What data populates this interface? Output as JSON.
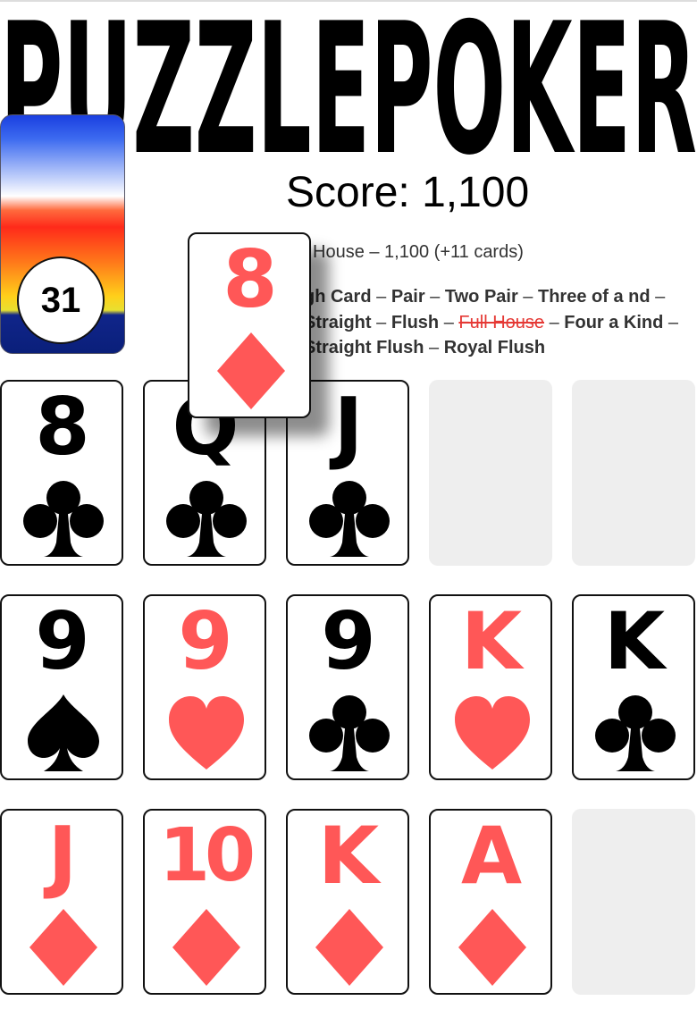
{
  "game": {
    "title": "PUZZLEPOKER",
    "score_text": "Score: 1,100",
    "last_hand": "l House – 1,100 (+11 cards)",
    "timer_value": "31",
    "timer_level": 0.31,
    "hands": [
      {
        "label": "gh Card",
        "done": false
      },
      {
        "label": "Pair",
        "done": false
      },
      {
        "label": "Two Pair",
        "done": false
      },
      {
        "label": "Three of a nd",
        "done": false
      },
      {
        "label": "Straight",
        "done": false
      },
      {
        "label": "Flush",
        "done": false
      },
      {
        "label": "Full House",
        "done": true
      },
      {
        "label": "Four a Kind",
        "done": false
      },
      {
        "label": "Straight Flush",
        "done": false
      },
      {
        "label": "Royal Flush",
        "done": false
      }
    ],
    "separator": " – ",
    "colors": {
      "red": "#ff5757",
      "black": "#000000",
      "empty_slot": "#eeeeee"
    }
  },
  "held_card": {
    "rank": "8",
    "suit": "diamond",
    "color": "red"
  },
  "grid": [
    [
      {
        "rank": "8",
        "suit": "club",
        "color": "black"
      },
      {
        "rank": "Q",
        "suit": "club",
        "color": "black"
      },
      {
        "rank": "J",
        "suit": "club",
        "color": "black"
      },
      null,
      null
    ],
    [
      {
        "rank": "9",
        "suit": "spade",
        "color": "black"
      },
      {
        "rank": "9",
        "suit": "heart",
        "color": "red"
      },
      {
        "rank": "9",
        "suit": "club",
        "color": "black"
      },
      {
        "rank": "K",
        "suit": "heart",
        "color": "red"
      },
      {
        "rank": "K",
        "suit": "club",
        "color": "black"
      }
    ],
    [
      {
        "rank": "J",
        "suit": "diamond",
        "color": "red"
      },
      {
        "rank": "10",
        "suit": "diamond",
        "color": "red"
      },
      {
        "rank": "K",
        "suit": "diamond",
        "color": "red"
      },
      {
        "rank": "A",
        "suit": "diamond",
        "color": "red"
      },
      null
    ]
  ]
}
